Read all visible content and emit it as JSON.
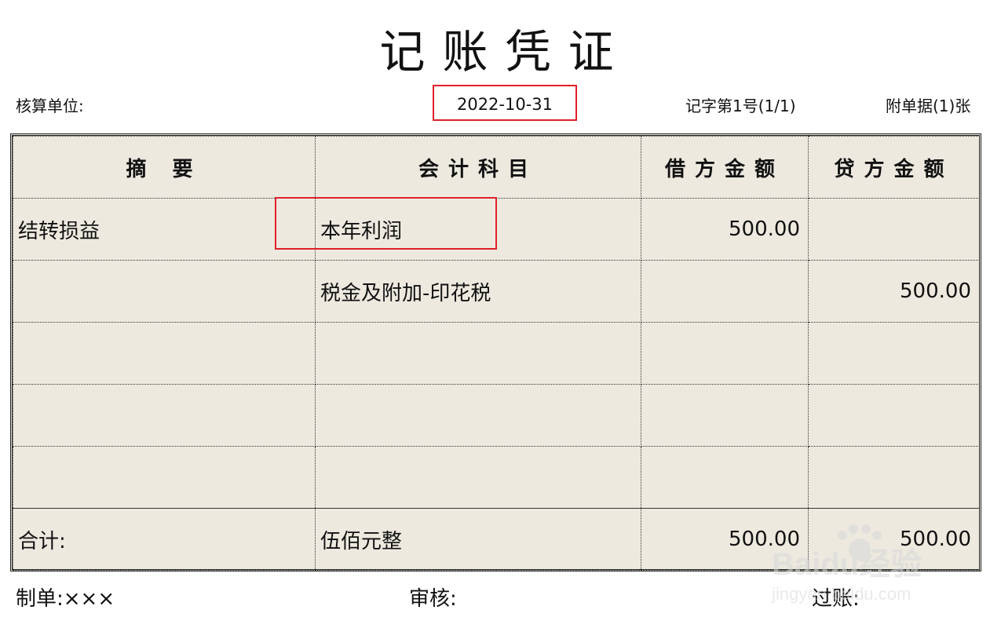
{
  "title": "记账凭证",
  "header": {
    "unit_label": "核算单位:",
    "date": "2022-10-31",
    "voucher_no": "记字第1号(1/1)",
    "attachments": "附单据(1)张"
  },
  "table": {
    "columns": [
      "摘 要",
      "会计科目",
      "借方金额",
      "贷方金额"
    ],
    "rows": [
      {
        "summary": "结转损益",
        "account": "本年利润",
        "debit": "500.00",
        "credit": ""
      },
      {
        "summary": "",
        "account": "税金及附加-印花税",
        "debit": "",
        "credit": "500.00"
      },
      {
        "summary": "",
        "account": "",
        "debit": "",
        "credit": ""
      },
      {
        "summary": "",
        "account": "",
        "debit": "",
        "credit": ""
      },
      {
        "summary": "",
        "account": "",
        "debit": "",
        "credit": ""
      }
    ],
    "total": {
      "label": "合计:",
      "amount_words": "伍佰元整",
      "debit": "500.00",
      "credit": "500.00"
    }
  },
  "footer": {
    "maker": "制单:×××",
    "reviewer": "审核:",
    "poster": "过账:"
  },
  "highlight_color": "#e0202a",
  "watermark": {
    "text": "Baidu经验",
    "url_text": "jingyan.baidu.com",
    "icon": "paw-icon"
  }
}
